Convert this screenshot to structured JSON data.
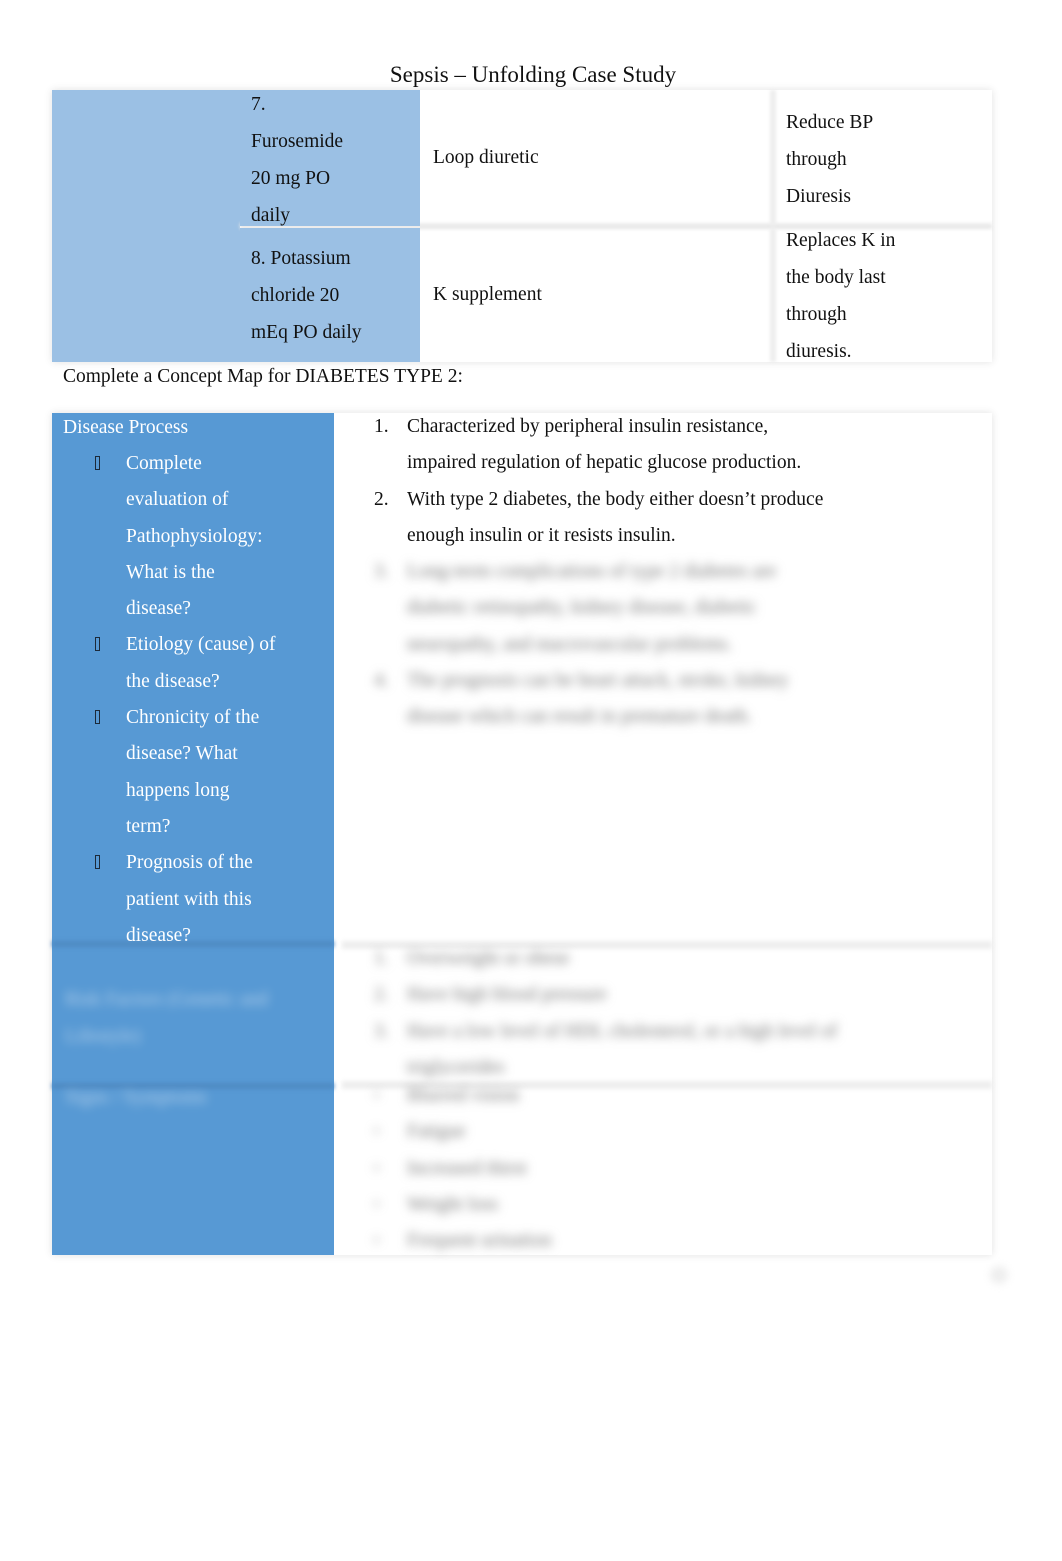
{
  "page": {
    "title": "Sepsis – Unfolding Case Study"
  },
  "medications": [
    {
      "name_lines": [
        "7.",
        "Furosemide",
        "20 mg PO",
        "daily"
      ],
      "classification": "Loop diuretic",
      "purpose_lines": [
        "Reduce BP",
        "through",
        "Diuresis"
      ]
    },
    {
      "name_lines": [
        "8. Potassium",
        "chloride 20",
        "mEq PO daily"
      ],
      "classification": "K supplement",
      "purpose_lines": [
        "Replaces K in",
        "the body last",
        "through",
        "diuresis."
      ]
    }
  ],
  "concept_map": {
    "heading": "Complete a Concept Map for DIABETES TYPE 2:",
    "sections": [
      {
        "label": "Disease Process",
        "prompts": [
          [
            "Complete",
            "evaluation of",
            "Pathophysiology:",
            "What is the",
            "disease?"
          ],
          [
            "Etiology (cause) of",
            "the disease?"
          ],
          [
            "Chronicity of the",
            "disease? What",
            "happens long",
            "term?"
          ],
          [
            "Prognosis of the",
            "patient with this",
            "disease?"
          ]
        ],
        "answers": [
          {
            "num": "1.",
            "lines": [
              "Characterized by peripheral insulin resistance,",
              "impaired regulation of hepatic glucose production."
            ],
            "blurred": false
          },
          {
            "num": "2.",
            "lines": [
              "With type 2 diabetes, the body either doesn’t produce",
              "enough insulin or it resists insulin."
            ],
            "blurred": false
          },
          {
            "num": "3.",
            "lines": [
              "Long-term complications of type 2 diabetes are",
              "diabetic retinopathy, kidney disease, diabetic",
              "neuropathy, and macrovascular problems."
            ],
            "blurred": true
          },
          {
            "num": "4.",
            "lines": [
              "The prognosis can be heart attack, stroke, kidney",
              "disease which can result in premature death."
            ],
            "blurred": true
          }
        ]
      },
      {
        "label": "Risk Factors (Genetic and Lifestyle)",
        "blurred": true,
        "answers": [
          {
            "num": "1.",
            "lines": [
              "Overweight or obese"
            ],
            "blurred": true
          },
          {
            "num": "2.",
            "lines": [
              "Have high blood pressure"
            ],
            "blurred": true
          },
          {
            "num": "3.",
            "lines": [
              "Have a low level of HDL cholesterol, or a high level of",
              "triglycerides"
            ],
            "blurred": true
          }
        ]
      },
      {
        "label": "Signs / Symptoms",
        "blurred": true,
        "answers": [
          {
            "num": "•",
            "lines": [
              "Blurred vision"
            ],
            "blurred": true
          },
          {
            "num": "•",
            "lines": [
              "Fatigue"
            ],
            "blurred": true
          },
          {
            "num": "•",
            "lines": [
              "Increased thirst"
            ],
            "blurred": true
          },
          {
            "num": "•",
            "lines": [
              "Weight loss"
            ],
            "blurred": true
          },
          {
            "num": "•",
            "lines": [
              "Frequent urination"
            ],
            "blurred": true
          }
        ]
      }
    ]
  },
  "colors": {
    "med_table_fill": "#9bc0e4",
    "concept_left_fill": "#5799d4"
  }
}
